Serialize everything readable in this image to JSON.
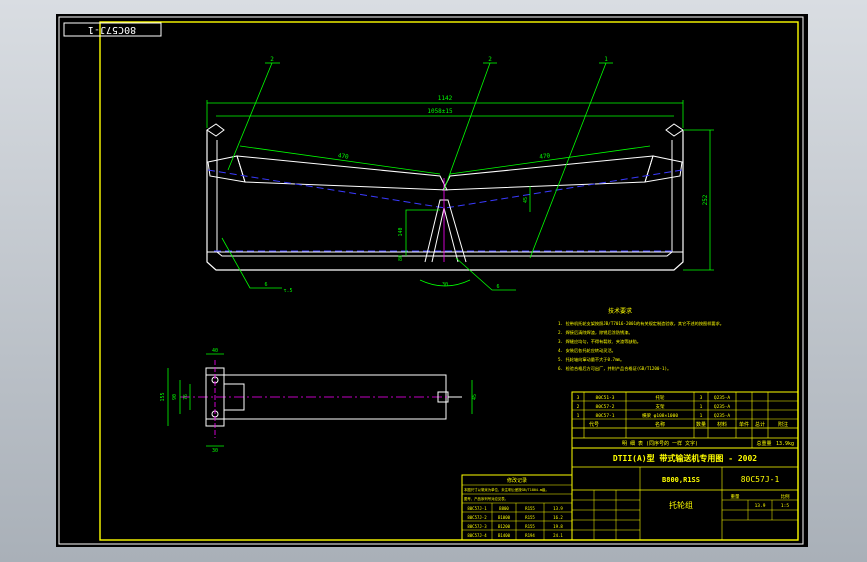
{
  "drawing_number_stamp": "80C57J-1",
  "balloons": [
    "2",
    "2",
    "1",
    "6",
    "6",
    "6"
  ],
  "dimensions": {
    "overall": "1142",
    "inner": "1058±15",
    "left_len": "470",
    "right_len": "470",
    "height": "252",
    "small_a": "45",
    "small_b": "140",
    "small_c": "30",
    "angle": "30",
    "bot": "80",
    "side_h": "155",
    "side_b": "90",
    "side_c": "76",
    "side_top": "40",
    "right_tag": "τ.5"
  },
  "tech_notes": {
    "title": "技术要求",
    "lines": [
      "1. 拉带机托轮支架按照JB/T7016-2001的有关规定制造验收，其它不述的按图样要求。",
      "2. 焊接后清除焊渣，除锈后涂防锈漆。",
      "3. 焊缝应均匀，不得有裂纹、夹渣等缺陷。",
      "4. 安装后各托轮应转动灵活。",
      "5. 托轮轴向窜动量不大于0.7mm。",
      "6. 检验合格后方可出厂，并附产品合格证(GB/T1200-1)。"
    ]
  },
  "parts_table": {
    "rows": [
      [
        "3",
        "80C51-3",
        "托轮",
        "3",
        "Q235-A",
        "",
        ""
      ],
      [
        "2",
        "80C57-2",
        "支架",
        "1",
        "Q235-A",
        "",
        ""
      ],
      [
        "1",
        "80C57-1",
        "横梁 φ108×1000",
        "1",
        "Q235-A",
        "",
        ""
      ]
    ],
    "header": [
      "代号",
      "名称",
      "数量",
      "材料",
      "单件",
      "总计",
      "附注"
    ],
    "total_label": "总重量",
    "total_value": "13.9kg",
    "footer": "明  细  表  (同序号的 一样 文字)"
  },
  "title_block": {
    "series": "DTII(A)型  带式输送机专用图 - 2002",
    "spec": "B800,R1SS",
    "drawing_no": "80C57J-1",
    "name": "托轮组",
    "scale_label": "比例",
    "scale": "1:5",
    "weight_label": "重量",
    "weight": "13.9"
  },
  "revision_table": {
    "title": "修改记录",
    "note1": "本图尺寸以毫米为单位，未注明公差按GB/T1804-m级。",
    "note2": "图号、产品序列号对应见表。",
    "rows": [
      [
        "80C57J-1",
        "B800",
        "R155",
        "13.9"
      ],
      [
        "80C57J-2",
        "B1000",
        "R155",
        "16.2"
      ],
      [
        "80C57J-3",
        "B1200",
        "R155",
        "19.8"
      ],
      [
        "80C57J-4",
        "B1400",
        "R194",
        "24.1"
      ]
    ]
  },
  "colors": {
    "frame": "#ffff00",
    "geometry": "#ffffff",
    "dimension": "#00ff00",
    "centerline": "#3a3aff",
    "magenta": "#ff00ff",
    "background": "#000000"
  }
}
